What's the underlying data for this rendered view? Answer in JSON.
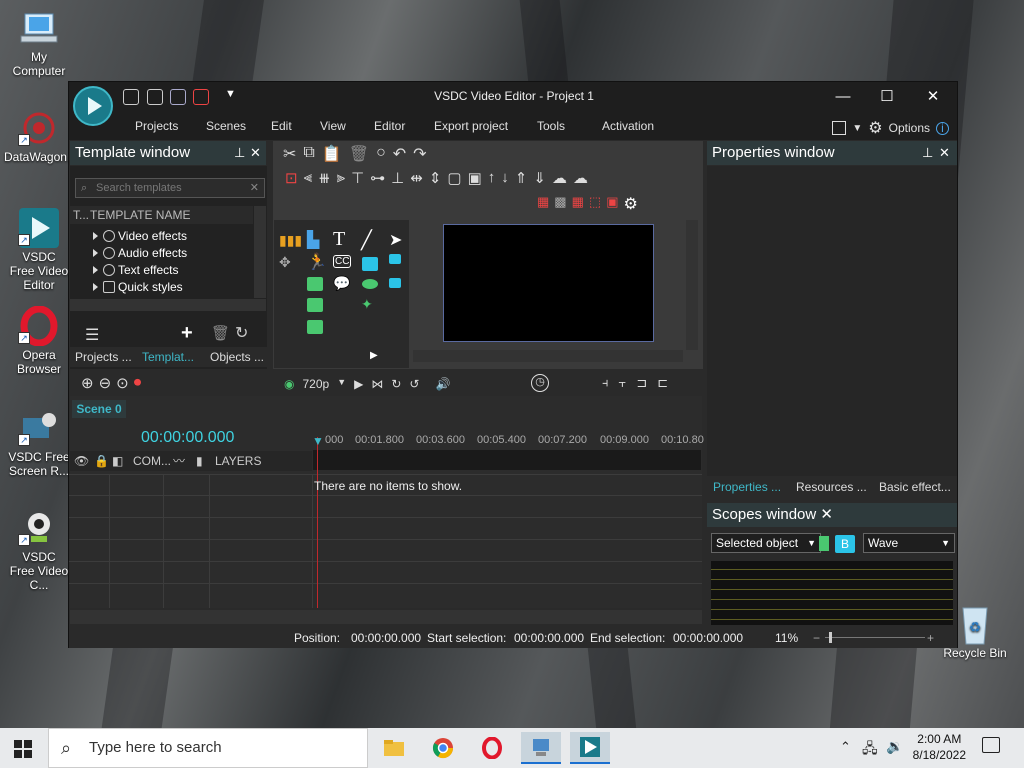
{
  "desktop": {
    "icons": [
      {
        "label": "My Computer",
        "color": "#9fd4ff"
      },
      {
        "label": "DataWagon...",
        "color": "#c0282c"
      },
      {
        "label": "VSDC Free Video Editor",
        "color": "#1a7a8a"
      },
      {
        "label": "Opera Browser",
        "color": "#e1182c"
      },
      {
        "label": "VSDC Free Screen R...",
        "color": "#3a7aa0"
      },
      {
        "label": "VSDC Free Video C...",
        "color": "#86c440"
      },
      {
        "label": "Recycle Bin",
        "color": "#bcd8ea"
      }
    ]
  },
  "window": {
    "title": "VSDC Video Editor - Project 1",
    "menu": [
      "Projects",
      "Scenes",
      "Edit",
      "View",
      "Editor",
      "Export project",
      "Tools",
      "Activation"
    ],
    "options_label": "Options",
    "controls": {
      "minimize": "—",
      "maximize": "☐",
      "close": "✕"
    }
  },
  "template_window": {
    "title": "Template window",
    "search_placeholder": "Search templates",
    "col_t": "T...",
    "col_name": "TEMPLATE NAME",
    "items": [
      "Video effects",
      "Audio effects",
      "Text effects",
      "Quick styles"
    ],
    "tabs": [
      "Projects ...",
      "Templat...",
      "Objects ..."
    ]
  },
  "properties_window": {
    "title": "Properties window",
    "tabs": [
      "Properties ...",
      "Resources ...",
      "Basic effect..."
    ]
  },
  "scopes_window": {
    "title": "Scopes window",
    "source": "Selected object",
    "b_label": "B",
    "mode": "Wave"
  },
  "toolbar": {
    "resolution": "720p"
  },
  "timeline": {
    "scene_tab": "Scene 0",
    "timecode": "00:00:00.000",
    "ruler": [
      "000",
      "00:01.800",
      "00:03.600",
      "00:05.400",
      "00:07.200",
      "00:09.000",
      "00:10.80"
    ],
    "col_com": "COM...",
    "col_layers": "LAYERS",
    "empty_message": "There are no items to show."
  },
  "status": {
    "position_label": "Position:",
    "position_value": "00:00:00.000",
    "start_label": "Start selection:",
    "start_value": "00:00:00.000",
    "end_label": "End selection:",
    "end_value": "00:00:00.000",
    "zoom": "11%"
  },
  "taskbar": {
    "search_placeholder": "Type here to search",
    "time": "2:00 AM",
    "date": "8/18/2022"
  }
}
